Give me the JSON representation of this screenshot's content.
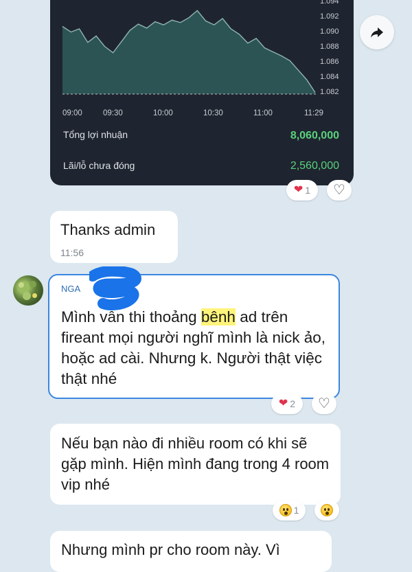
{
  "trade_card": {
    "y_ticks": [
      "1.094",
      "1.092",
      "1.090",
      "1.088",
      "1.086",
      "1.084",
      "1.082"
    ],
    "x_ticks": [
      "09:00",
      "09:30",
      "10:00",
      "10:30",
      "11:00",
      "11:29"
    ],
    "total_profit_label": "Tổng lợi nhuận",
    "total_profit_value": "8,060,000",
    "unrealized_label": "Lãi/lỗ chưa đóng",
    "unrealized_value": "2,560,000",
    "value_color": "#5ad17c",
    "reaction_count": "1"
  },
  "chart_data": {
    "type": "area",
    "x": [
      "09:00",
      "09:05",
      "09:10",
      "09:15",
      "09:20",
      "09:25",
      "09:30",
      "09:35",
      "09:40",
      "09:45",
      "09:50",
      "09:55",
      "10:00",
      "10:05",
      "10:10",
      "10:15",
      "10:20",
      "10:25",
      "10:30",
      "10:35",
      "10:40",
      "10:45",
      "10:50",
      "10:55",
      "11:00",
      "11:05",
      "11:10",
      "11:15",
      "11:20",
      "11:25",
      "11:29"
    ],
    "series": [
      {
        "values": [
          1.0905,
          1.0898,
          1.0902,
          1.0885,
          1.0893,
          1.088,
          1.0872,
          1.0886,
          1.09,
          1.0908,
          1.0903,
          1.0911,
          1.0907,
          1.0913,
          1.091,
          1.0916,
          1.0925,
          1.0912,
          1.0907,
          1.0915,
          1.0902,
          1.0895,
          1.0884,
          1.089,
          1.0878,
          1.0873,
          1.0868,
          1.0862,
          1.085,
          1.0838,
          1.0822
        ]
      }
    ],
    "xlabel": "",
    "ylabel": "",
    "ylim": [
      1.082,
      1.094
    ],
    "xticks": [
      "09:00",
      "09:30",
      "10:00",
      "10:30",
      "11:00",
      "11:29"
    ],
    "yticks": [
      1.094,
      1.092,
      1.09,
      1.088,
      1.086,
      1.084,
      1.082
    ],
    "grid": false,
    "line_color": "#8fb5b1",
    "fill_color": "#2f5d5a"
  },
  "messages": {
    "thanks": {
      "text": "Thanks admin",
      "time": "11:56"
    },
    "long": {
      "sender": "NGA",
      "text_before": "Mình vẫn thi thoảng ",
      "highlight": "bênh",
      "text_after": " ad trên fireant mọi người nghĩ mình là nick ảo, hoặc ad cài. Nhưng k. Người thật việc thật nhé",
      "reaction_count": "2"
    },
    "rooms": {
      "text": "Nếu bạn nào đi nhiều room có khi sẽ gặp mình. Hiện mình đang trong 4 room vip nhé",
      "reaction_count": "1"
    },
    "partial": {
      "text": "Nhưng mình pr cho room này. Vì"
    }
  },
  "colors": {
    "background": "#dce7ef",
    "card_bg": "#1f2530",
    "selected_border": "#3a86e0",
    "heart": "#e0334d"
  },
  "icons": [
    "forward-icon",
    "heart-icon",
    "heart-outline-icon",
    "surprised-emoji-icon"
  ]
}
